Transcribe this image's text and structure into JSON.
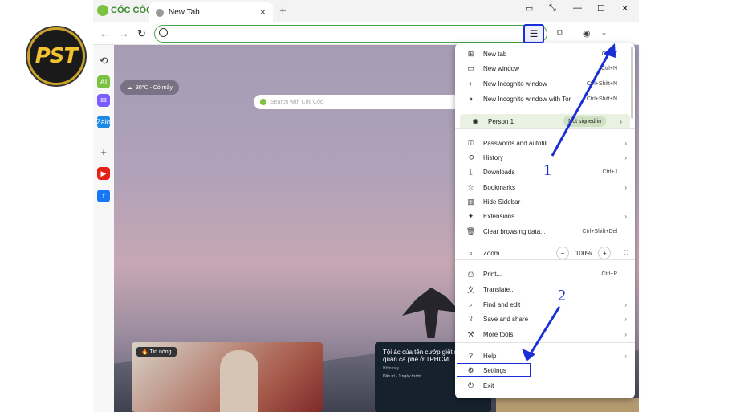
{
  "logo": {
    "text": "PST"
  },
  "browser": {
    "brand": "CỐC CỐC",
    "tab_title": "New Tab",
    "new_tab": "+",
    "min": "—",
    "max": "☐",
    "close": "✕",
    "tab_close": "✕",
    "omnibox_value": ""
  },
  "content": {
    "weather": "30℃ - Có mây",
    "search_placeholder": "Search with Cốc Cốc",
    "news": {
      "badge": "Tin nóng",
      "headline": "Tội ác của tên cướp giết nhân viên quán cà phê ở TPHCM",
      "meta": "Hôm nay",
      "source": "Dân trí · 1 ngày trước"
    }
  },
  "sidebar": {
    "items": [
      {
        "name": "history-icon",
        "label": "⟲",
        "color": "#444"
      },
      {
        "name": "ai-icon",
        "label": "AI",
        "color": "#7cc242"
      },
      {
        "name": "messenger-icon",
        "label": "✉",
        "color": "#7b5cff"
      },
      {
        "name": "zalo-icon",
        "label": "Zalo",
        "color": "#1e88e5"
      },
      {
        "name": "add-icon",
        "label": "+",
        "color": "#444"
      },
      {
        "name": "youtube-icon",
        "label": "▶",
        "color": "#e62117"
      },
      {
        "name": "facebook-icon",
        "label": "f",
        "color": "#1877f2"
      }
    ]
  },
  "menu": {
    "items": [
      {
        "name": "menu-new-tab",
        "icon": "⊞",
        "label": "New tab",
        "shortcut": "Ctrl+T",
        "arrow": ""
      },
      {
        "name": "menu-new-window",
        "icon": "▭",
        "label": "New window",
        "shortcut": "Ctrl+N",
        "arrow": ""
      },
      {
        "name": "menu-new-incognito",
        "icon": "◐",
        "label": "New Incognito window",
        "shortcut": "Ctrl+Shift+N",
        "arrow": ""
      },
      {
        "name": "menu-new-incognito-tor",
        "icon": "◑",
        "label": "New Incognito window with Tor",
        "shortcut": "Ctrl+Shift+N",
        "arrow": ""
      },
      {
        "name": "menu-passwords",
        "icon": "⚿",
        "label": "Passwords and autofill",
        "shortcut": "",
        "arrow": "›"
      },
      {
        "name": "menu-history",
        "icon": "⟲",
        "label": "History",
        "shortcut": "",
        "arrow": "›"
      },
      {
        "name": "menu-downloads",
        "icon": "⤓",
        "label": "Downloads",
        "shortcut": "Ctrl+J",
        "arrow": ""
      },
      {
        "name": "menu-bookmarks",
        "icon": "☆",
        "label": "Bookmarks",
        "shortcut": "",
        "arrow": "›"
      },
      {
        "name": "menu-hide-sidebar",
        "icon": "▥",
        "label": "Hide Sidebar",
        "shortcut": "",
        "arrow": ""
      },
      {
        "name": "menu-extensions",
        "icon": "✦",
        "label": "Extensions",
        "shortcut": "",
        "arrow": "›"
      },
      {
        "name": "menu-clear-data",
        "icon": "🗑",
        "label": "Clear browsing data...",
        "shortcut": "Ctrl+Shift+Del",
        "arrow": ""
      },
      {
        "name": "menu-print",
        "icon": "⎙",
        "label": "Print...",
        "shortcut": "Ctrl+P",
        "arrow": ""
      },
      {
        "name": "menu-translate",
        "icon": "文",
        "label": "Translate...",
        "shortcut": "",
        "arrow": ""
      },
      {
        "name": "menu-find-edit",
        "icon": "⌕",
        "label": "Find and edit",
        "shortcut": "",
        "arrow": "›"
      },
      {
        "name": "menu-save-share",
        "icon": "⇪",
        "label": "Save and share",
        "shortcut": "",
        "arrow": "›"
      },
      {
        "name": "menu-more-tools",
        "icon": "⚒",
        "label": "More tools",
        "shortcut": "",
        "arrow": "›"
      },
      {
        "name": "menu-help",
        "icon": "?",
        "label": "Help",
        "shortcut": "",
        "arrow": "›"
      },
      {
        "name": "menu-settings",
        "icon": "⚙",
        "label": "Settings",
        "shortcut": "",
        "arrow": ""
      },
      {
        "name": "menu-exit",
        "icon": "⏻",
        "label": "Exit",
        "shortcut": "",
        "arrow": ""
      }
    ],
    "person": {
      "label": "Person 1",
      "status": "Not signed in"
    },
    "zoom": {
      "label": "Zoom",
      "minus": "−",
      "value": "100%",
      "plus": "+",
      "full": "⛶"
    }
  },
  "annotations": {
    "label1": "1",
    "label2": "2",
    "color": "#1a2fd6"
  }
}
